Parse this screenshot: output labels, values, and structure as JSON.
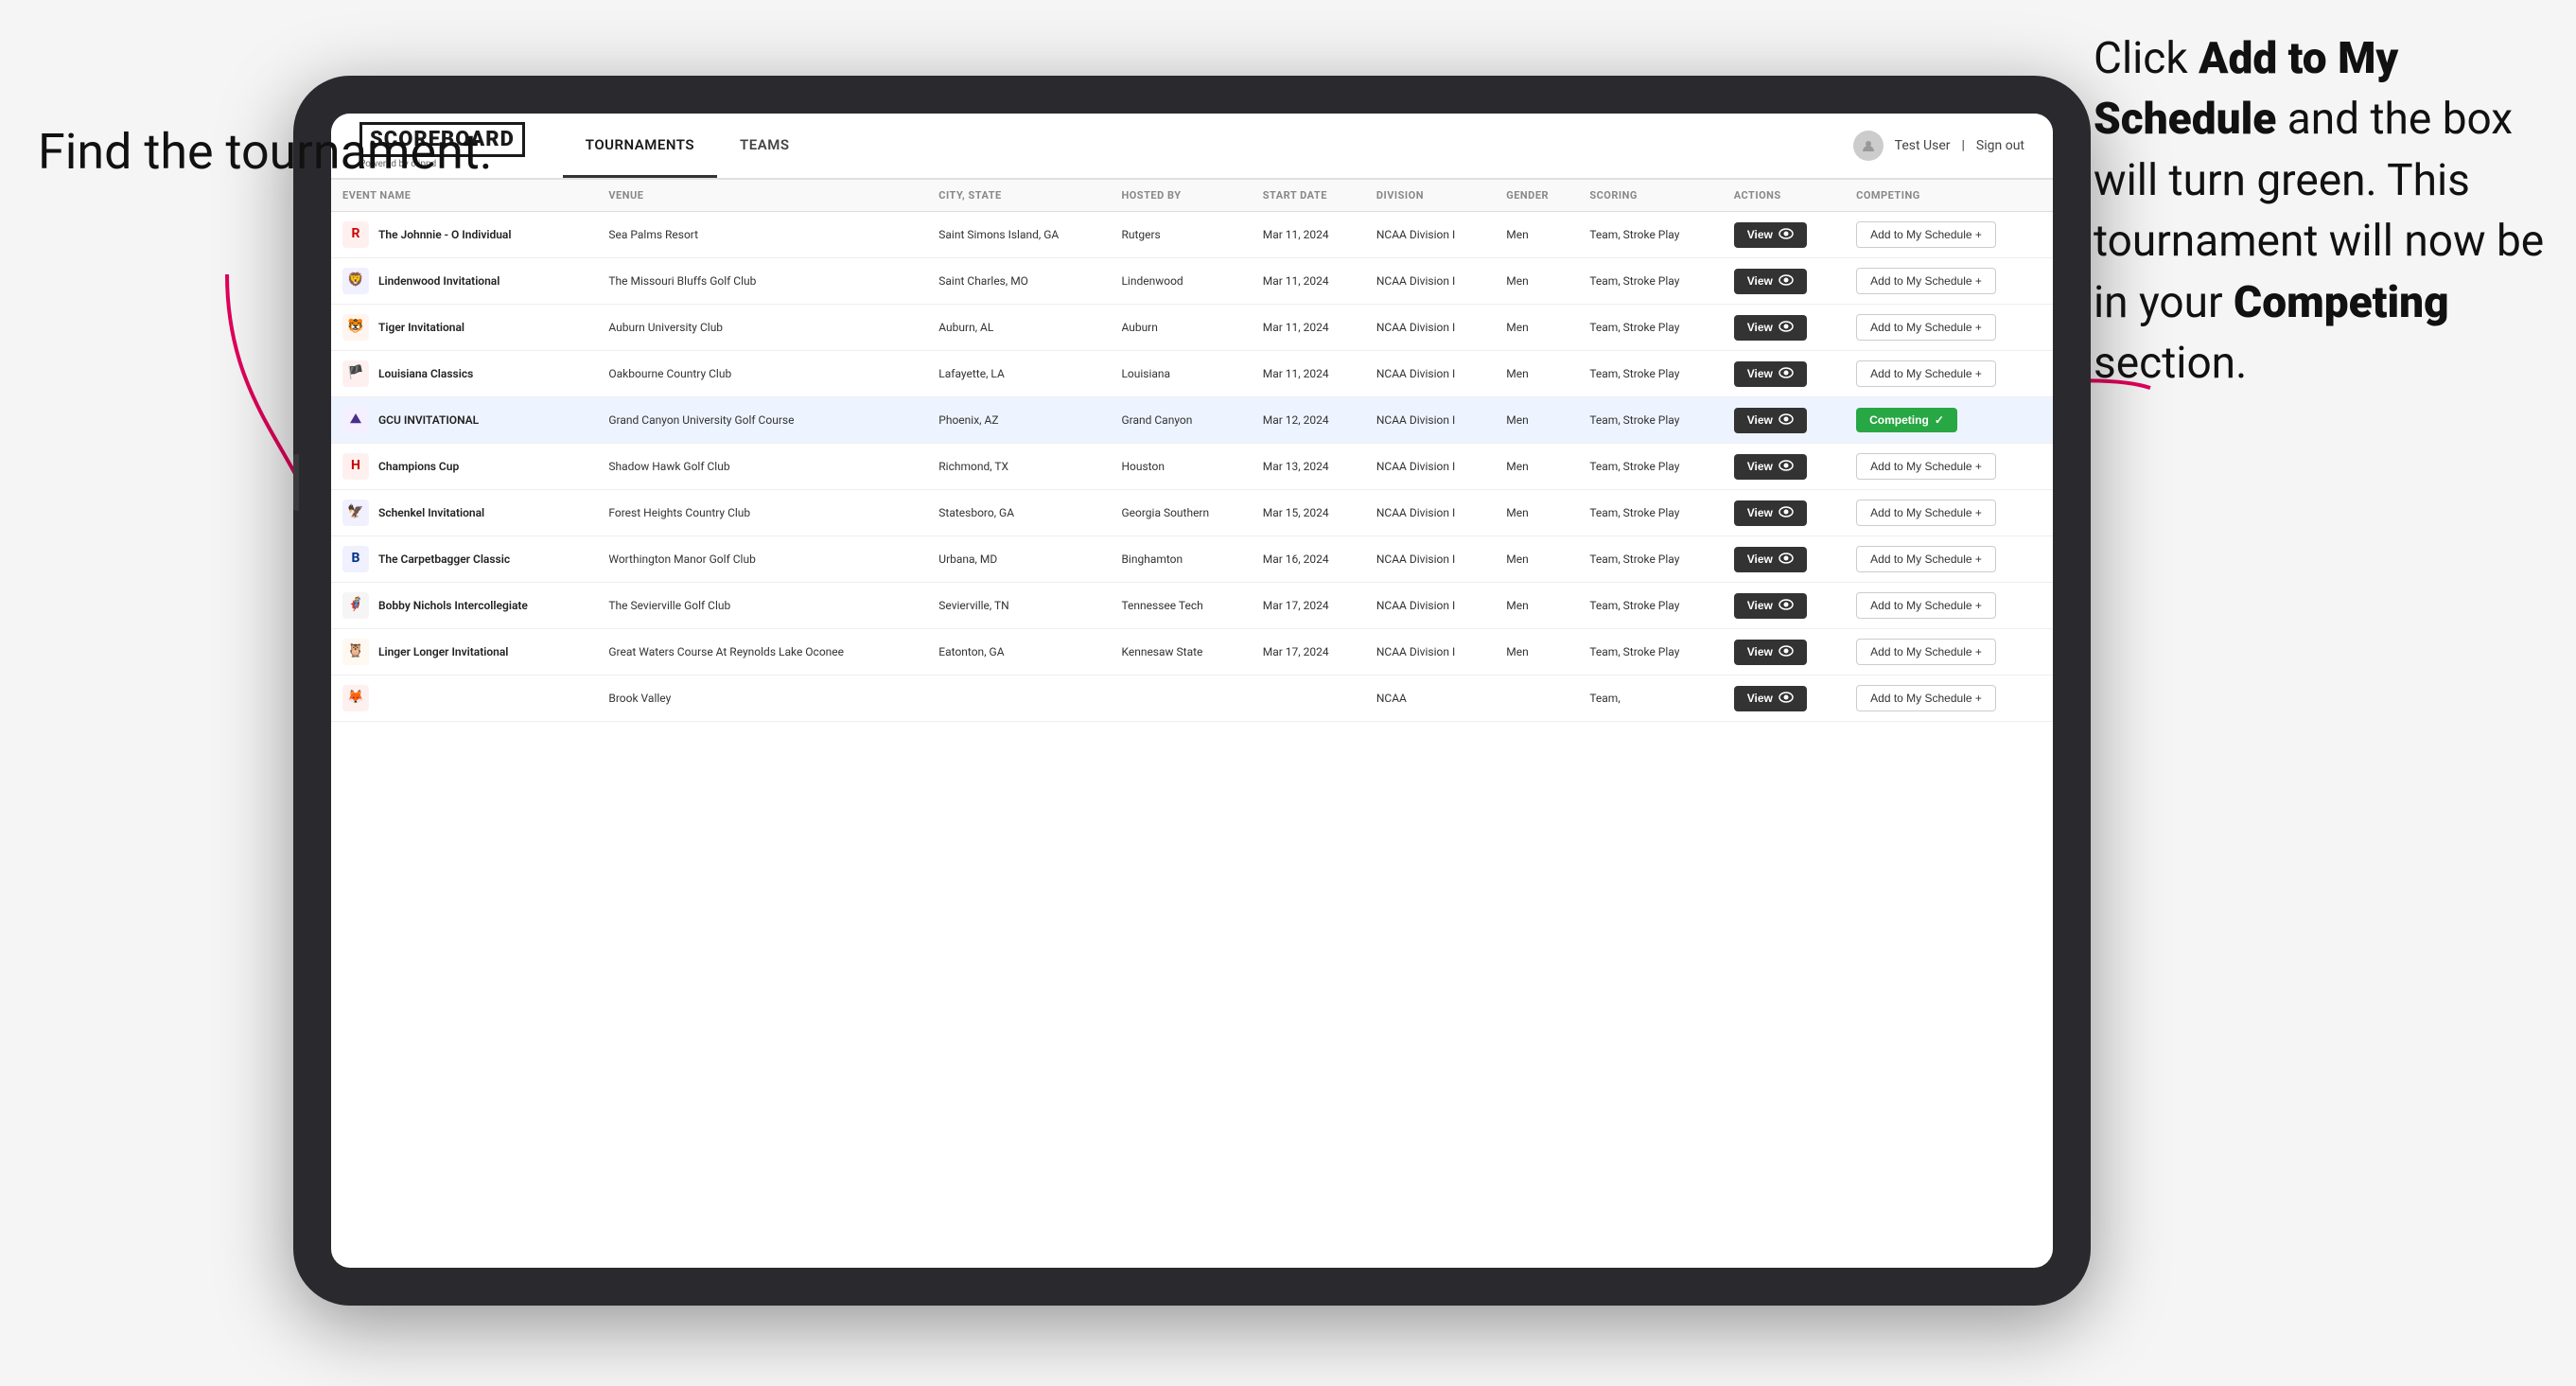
{
  "page": {
    "background": "#f5f5f5"
  },
  "annotations": {
    "left": "Find the\ntournament.",
    "right_line1": "Click ",
    "right_bold1": "Add to My\nSchedule",
    "right_line2": " and the\nbox will turn green.\nThis tournament\nwill now be in\nyour ",
    "right_bold2": "Competing",
    "right_line3": "\nsection."
  },
  "header": {
    "logo": "SCOREBOARD",
    "logo_sub": "Powered by clippd",
    "tabs": [
      {
        "label": "TOURNAMENTS",
        "active": true
      },
      {
        "label": "TEAMS",
        "active": false
      }
    ],
    "user": "Test User",
    "sign_out": "Sign out"
  },
  "table": {
    "columns": [
      "EVENT NAME",
      "VENUE",
      "CITY, STATE",
      "HOSTED BY",
      "START DATE",
      "DIVISION",
      "GENDER",
      "SCORING",
      "ACTIONS",
      "COMPETING"
    ],
    "rows": [
      {
        "id": 1,
        "logo": "🅁",
        "logo_color": "#cc0000",
        "name": "The Johnnie - O Individual",
        "venue": "Sea Palms Resort",
        "city": "Saint Simons Island, GA",
        "hosted_by": "Rutgers",
        "start_date": "Mar 11, 2024",
        "division": "NCAA Division I",
        "gender": "Men",
        "scoring": "Team, Stroke Play",
        "action": "View",
        "competing_status": "add",
        "competing_label": "Add to My Schedule +",
        "highlighted": false
      },
      {
        "id": 2,
        "logo": "🦁",
        "logo_color": "#003087",
        "name": "Lindenwood Invitational",
        "venue": "The Missouri Bluffs Golf Club",
        "city": "Saint Charles, MO",
        "hosted_by": "Lindenwood",
        "start_date": "Mar 11, 2024",
        "division": "NCAA Division I",
        "gender": "Men",
        "scoring": "Team, Stroke Play",
        "action": "View",
        "competing_status": "add",
        "competing_label": "Add to My Schedule +",
        "highlighted": false
      },
      {
        "id": 3,
        "logo": "🐯",
        "logo_color": "#FF6600",
        "name": "Tiger Invitational",
        "venue": "Auburn University Club",
        "city": "Auburn, AL",
        "hosted_by": "Auburn",
        "start_date": "Mar 11, 2024",
        "division": "NCAA Division I",
        "gender": "Men",
        "scoring": "Team, Stroke Play",
        "action": "View",
        "competing_status": "add",
        "competing_label": "Add to My Schedule +",
        "highlighted": false
      },
      {
        "id": 4,
        "logo": "🏴",
        "logo_color": "#cc0000",
        "name": "Louisiana Classics",
        "venue": "Oakbourne Country Club",
        "city": "Lafayette, LA",
        "hosted_by": "Louisiana",
        "start_date": "Mar 11, 2024",
        "division": "NCAA Division I",
        "gender": "Men",
        "scoring": "Team, Stroke Play",
        "action": "View",
        "competing_status": "add",
        "competing_label": "Add to My Schedule +",
        "highlighted": false
      },
      {
        "id": 5,
        "logo": "⛰",
        "logo_color": "#4a2f8a",
        "name": "GCU INVITATIONAL",
        "venue": "Grand Canyon University Golf Course",
        "city": "Phoenix, AZ",
        "hosted_by": "Grand Canyon",
        "start_date": "Mar 12, 2024",
        "division": "NCAA Division I",
        "gender": "Men",
        "scoring": "Team, Stroke Play",
        "action": "View",
        "competing_status": "competing",
        "competing_label": "Competing ✓",
        "highlighted": true
      },
      {
        "id": 6,
        "logo": "H",
        "logo_color": "#cc0000",
        "name": "Champions Cup",
        "venue": "Shadow Hawk Golf Club",
        "city": "Richmond, TX",
        "hosted_by": "Houston",
        "start_date": "Mar 13, 2024",
        "division": "NCAA Division I",
        "gender": "Men",
        "scoring": "Team, Stroke Play",
        "action": "View",
        "competing_status": "add",
        "competing_label": "Add to My Schedule +",
        "highlighted": false
      },
      {
        "id": 7,
        "logo": "🦅",
        "logo_color": "#003087",
        "name": "Schenkel Invitational",
        "venue": "Forest Heights Country Club",
        "city": "Statesboro, GA",
        "hosted_by": "Georgia Southern",
        "start_date": "Mar 15, 2024",
        "division": "NCAA Division I",
        "gender": "Men",
        "scoring": "Team, Stroke Play",
        "action": "View",
        "competing_status": "add",
        "competing_label": "Add to My Schedule +",
        "highlighted": false
      },
      {
        "id": 8,
        "logo": "B",
        "logo_color": "#003087",
        "name": "The Carpetbagger Classic",
        "venue": "Worthington Manor Golf Club",
        "city": "Urbana, MD",
        "hosted_by": "Binghamton",
        "start_date": "Mar 16, 2024",
        "division": "NCAA Division I",
        "gender": "Men",
        "scoring": "Team, Stroke Play",
        "action": "View",
        "competing_status": "add",
        "competing_label": "Add to My Schedule +",
        "highlighted": false
      },
      {
        "id": 9,
        "logo": "🦸",
        "logo_color": "#4a4a4a",
        "name": "Bobby Nichols Intercollegiate",
        "venue": "The Sevierville Golf Club",
        "city": "Sevierville, TN",
        "hosted_by": "Tennessee Tech",
        "start_date": "Mar 17, 2024",
        "division": "NCAA Division I",
        "gender": "Men",
        "scoring": "Team, Stroke Play",
        "action": "View",
        "competing_status": "add",
        "competing_label": "Add to My Schedule +",
        "highlighted": false
      },
      {
        "id": 10,
        "logo": "🦉",
        "logo_color": "#cc6600",
        "name": "Linger Longer Invitational",
        "venue": "Great Waters Course At Reynolds Lake Oconee",
        "city": "Eatonton, GA",
        "hosted_by": "Kennesaw State",
        "start_date": "Mar 17, 2024",
        "division": "NCAA Division I",
        "gender": "Men",
        "scoring": "Team, Stroke Play",
        "action": "View",
        "competing_status": "add",
        "competing_label": "Add to My Schedule +",
        "highlighted": false
      },
      {
        "id": 11,
        "logo": "🦊",
        "logo_color": "#cc0000",
        "name": "",
        "venue": "Brook Valley",
        "city": "",
        "hosted_by": "",
        "start_date": "",
        "division": "NCAA",
        "gender": "",
        "scoring": "Team,",
        "action": "View",
        "competing_status": "add",
        "competing_label": "Add to My Schedule +",
        "highlighted": false
      }
    ]
  },
  "buttons": {
    "view_label": "View",
    "add_schedule_label": "Add to My Schedule +",
    "competing_label": "Competing ✓"
  }
}
